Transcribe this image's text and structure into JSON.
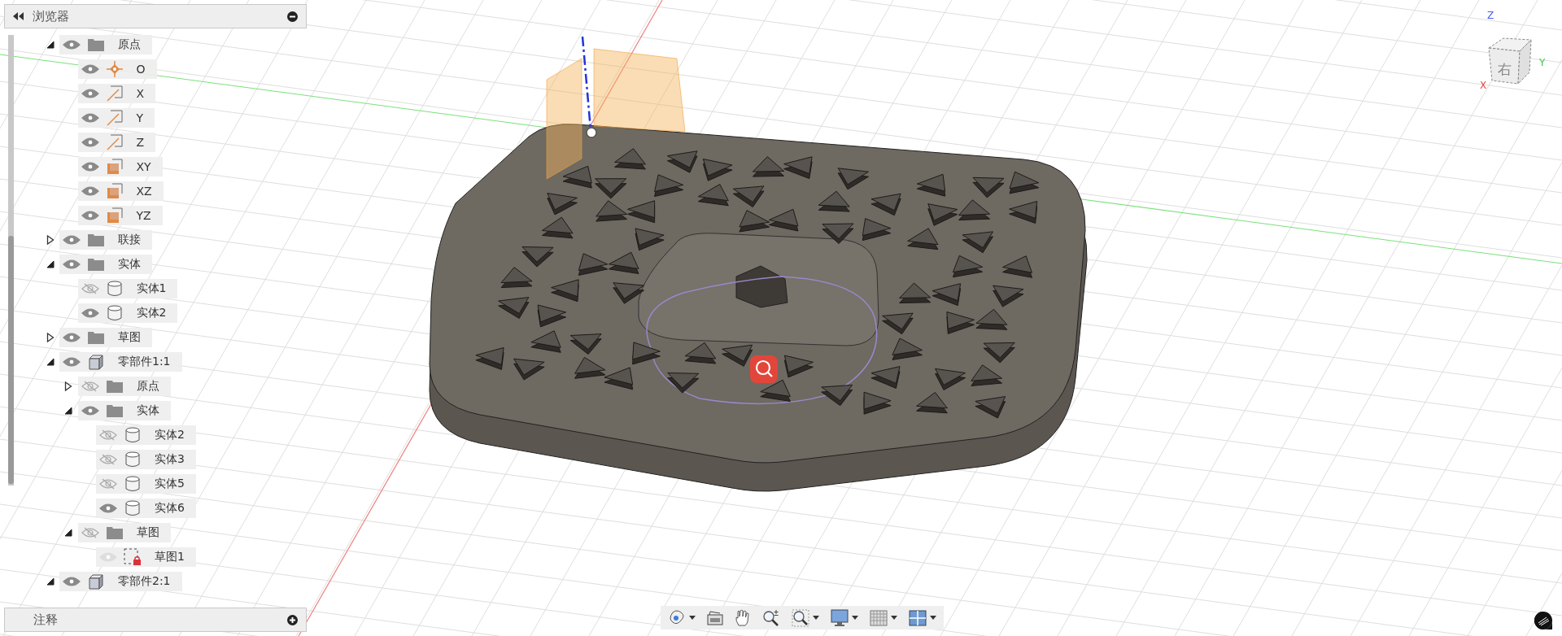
{
  "browser": {
    "title": "浏览器"
  },
  "tree": [
    {
      "label": "原点",
      "kind": "folder",
      "visible": true,
      "expanded": true,
      "children": [
        {
          "label": "O",
          "kind": "point",
          "visible": true
        },
        {
          "label": "X",
          "kind": "axis",
          "visible": true
        },
        {
          "label": "Y",
          "kind": "axis",
          "visible": true
        },
        {
          "label": "Z",
          "kind": "axis",
          "visible": true
        },
        {
          "label": "XY",
          "kind": "plane",
          "visible": true
        },
        {
          "label": "XZ",
          "kind": "plane",
          "visible": true
        },
        {
          "label": "YZ",
          "kind": "plane",
          "visible": true
        }
      ]
    },
    {
      "label": "联接",
      "kind": "folder",
      "visible": true,
      "expanded": false
    },
    {
      "label": "实体",
      "kind": "folder",
      "visible": true,
      "expanded": true,
      "children": [
        {
          "label": "实体1",
          "kind": "body",
          "visible": false
        },
        {
          "label": "实体2",
          "kind": "body",
          "visible": true
        }
      ]
    },
    {
      "label": "草图",
      "kind": "folder",
      "visible": true,
      "expanded": false
    },
    {
      "label": "零部件1:1",
      "kind": "component",
      "visible": true,
      "expanded": true,
      "children": [
        {
          "label": "原点",
          "kind": "folder",
          "visible": false,
          "expanded": false
        },
        {
          "label": "实体",
          "kind": "folder",
          "visible": true,
          "expanded": true,
          "children": [
            {
              "label": "实体2",
              "kind": "body",
              "visible": false
            },
            {
              "label": "实体3",
              "kind": "body",
              "visible": false
            },
            {
              "label": "实体5",
              "kind": "body",
              "visible": false
            },
            {
              "label": "实体6",
              "kind": "body",
              "visible": true
            }
          ]
        },
        {
          "label": "草图",
          "kind": "folder",
          "visible": false,
          "expanded": true,
          "children": [
            {
              "label": "草图1",
              "kind": "sketch",
              "visible": true,
              "disabled": true
            }
          ]
        }
      ]
    },
    {
      "label": "零部件2:1",
      "kind": "component",
      "visible": true,
      "expanded": true
    }
  ],
  "annotations_panel": {
    "title": "注释"
  },
  "viewcube": {
    "face_label": "右",
    "axis_labels": [
      {
        "label": "Z",
        "color": "#4a5cf0"
      },
      {
        "label": "Y",
        "color": "#33cc44"
      },
      {
        "label": "X",
        "color": "#ee4444"
      }
    ]
  },
  "toolbar": {
    "buttons": [
      {
        "kind": "orbit",
        "dropdown": true
      },
      {
        "kind": "look-at",
        "dropdown": false
      },
      {
        "kind": "pan",
        "dropdown": false
      },
      {
        "kind": "zoom",
        "dropdown": false
      },
      {
        "kind": "fit",
        "dropdown": true
      },
      {
        "kind": "display",
        "dropdown": true
      },
      {
        "kind": "grid",
        "dropdown": true
      },
      {
        "kind": "viewports",
        "dropdown": true
      }
    ]
  }
}
